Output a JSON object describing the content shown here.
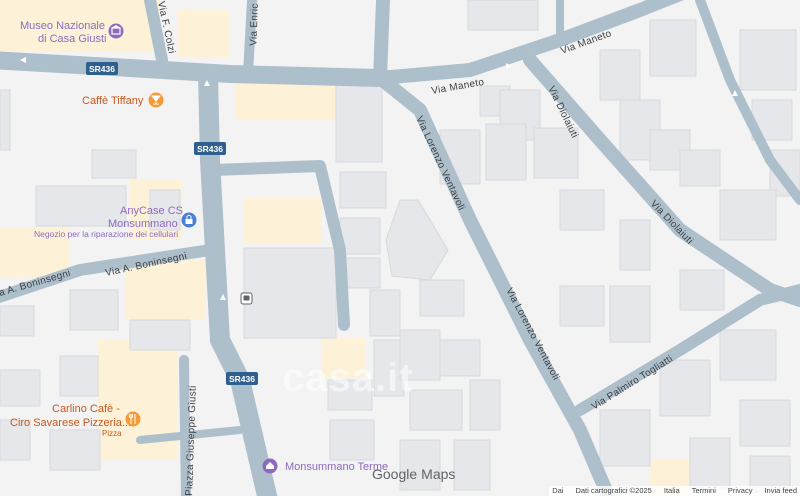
{
  "map": {
    "roads": {
      "sr436_top": "SR436",
      "sr436_mid": "SR436",
      "sr436_bottom": "SR436",
      "via_maneto_1": "Via Maneto",
      "via_maneto_2": "Via Maneto",
      "via_diolaiuti_1": "Via Diolaiuti",
      "via_diolaiuti_2": "Via Diolaiuti",
      "via_lorenzo_1": "Via Lorenzo Ventavoli",
      "via_lorenzo_2": "Via Lorenzo Ventavoli",
      "via_boninsegni_1": "Via A. Boninsegni",
      "via_boninsegni_2": "a A. Boninsegni",
      "via_palmiro": "Via Palmiro Togliatti",
      "piazza_giusti": "Piazza Giuseppe Giusti",
      "via_colzi": "Via F. Colzi",
      "via_enric": "Via Enric"
    },
    "pois": {
      "museo_line1": "Museo Nazionale",
      "museo_line2": "di Casa Giusti",
      "caffe_tiffany": "Caffè Tiffany",
      "anycase_line1": "AnyCase CS",
      "anycase_line2": "Monsummano",
      "anycase_sub": "Negozio per la riparazione dei cellulari",
      "carlino_line1": "Carlino Cafè -",
      "carlino_line2": "Ciro Savarese Pizzeria...",
      "carlino_sub": "Pizza",
      "monsummano_terme": "Monsummano Terme"
    },
    "icons": {
      "museum": "museum-icon",
      "cafe": "cafe-icon",
      "shop": "shopping-bag-icon",
      "restaurant": "restaurant-icon",
      "bus": "bus-stop-icon",
      "landmark": "landmark-icon"
    },
    "colors": {
      "background": "#f3f3f4",
      "road": "#aebfcc",
      "road_edge": "#9fb2c1",
      "building": "#e6e7ea",
      "building_edge": "#d6d8dc",
      "poi_area": "#fdf2d8",
      "poi_purple": "#8e6abe",
      "poi_orange": "#f29b38",
      "shield": "#2f5f8f"
    }
  },
  "watermark": "casa.it",
  "branding": {
    "google": "Google",
    "maps": "Maps"
  },
  "attribution": {
    "left": "Dai",
    "data": "Dati cartografici ©2025",
    "country": "Italia",
    "terms": "Termini",
    "privacy": "Privacy",
    "feedback": "Invia feed"
  }
}
